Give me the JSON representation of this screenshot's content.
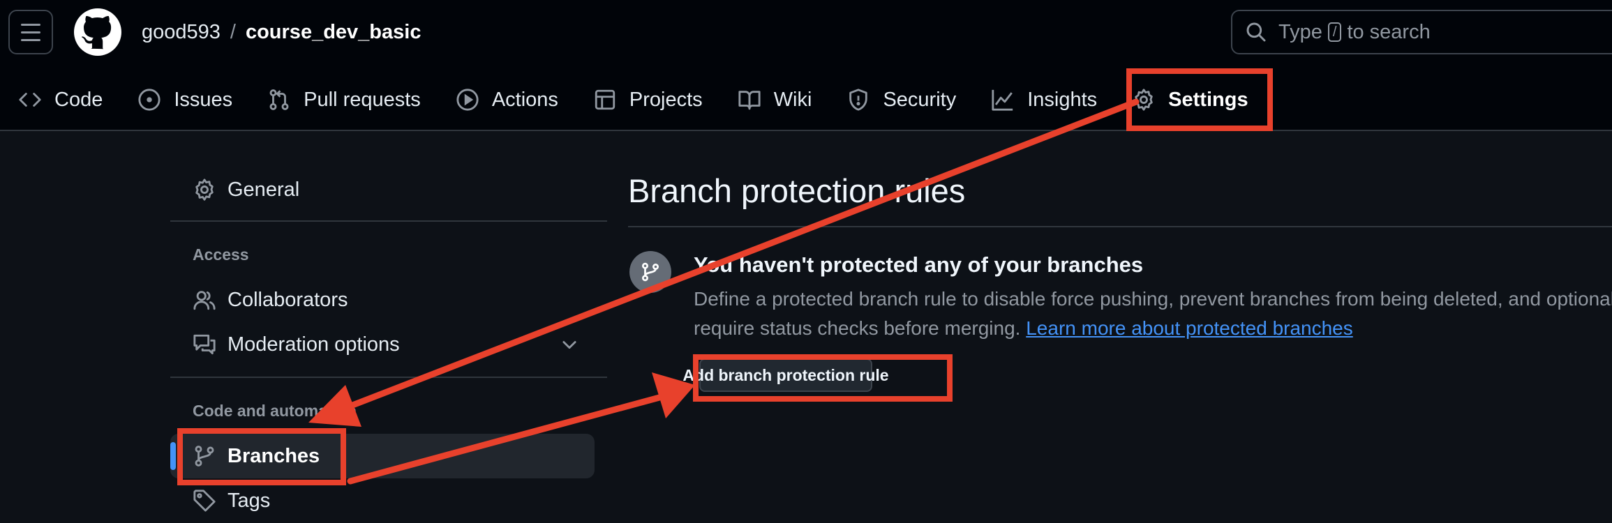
{
  "header": {
    "repo_owner": "good593",
    "repo_separator": "/",
    "repo_name": "course_dev_basic",
    "search": {
      "prefix": "Type",
      "key": "/",
      "suffix": "to search"
    }
  },
  "tabs": [
    {
      "label": "Code",
      "icon": "code-icon"
    },
    {
      "label": "Issues",
      "icon": "issue-opened-icon"
    },
    {
      "label": "Pull requests",
      "icon": "git-pull-request-icon"
    },
    {
      "label": "Actions",
      "icon": "play-icon"
    },
    {
      "label": "Projects",
      "icon": "table-icon"
    },
    {
      "label": "Wiki",
      "icon": "book-icon"
    },
    {
      "label": "Security",
      "icon": "shield-icon"
    },
    {
      "label": "Insights",
      "icon": "graph-icon"
    },
    {
      "label": "Settings",
      "icon": "gear-icon",
      "selected": true
    }
  ],
  "sidebar": {
    "general": "General",
    "access_heading": "Access",
    "collaborators": "Collaborators",
    "moderation": "Moderation options",
    "code_heading": "Code and automation",
    "branches": "Branches",
    "tags": "Tags"
  },
  "main": {
    "title": "Branch protection rules",
    "blank_title": "You haven't protected any of your branches",
    "blank_desc_1": "Define a protected branch rule to disable force pushing, prevent branches from being deleted, and optionally",
    "blank_desc_2": "require status checks before merging.",
    "learn_more": "Learn more about protected branches",
    "add_button": "Add branch protection rule"
  },
  "colors": {
    "background": "#0d1117",
    "header_background": "#010409",
    "accent_blue": "#4493f8",
    "annotation_red": "#e8412c"
  }
}
